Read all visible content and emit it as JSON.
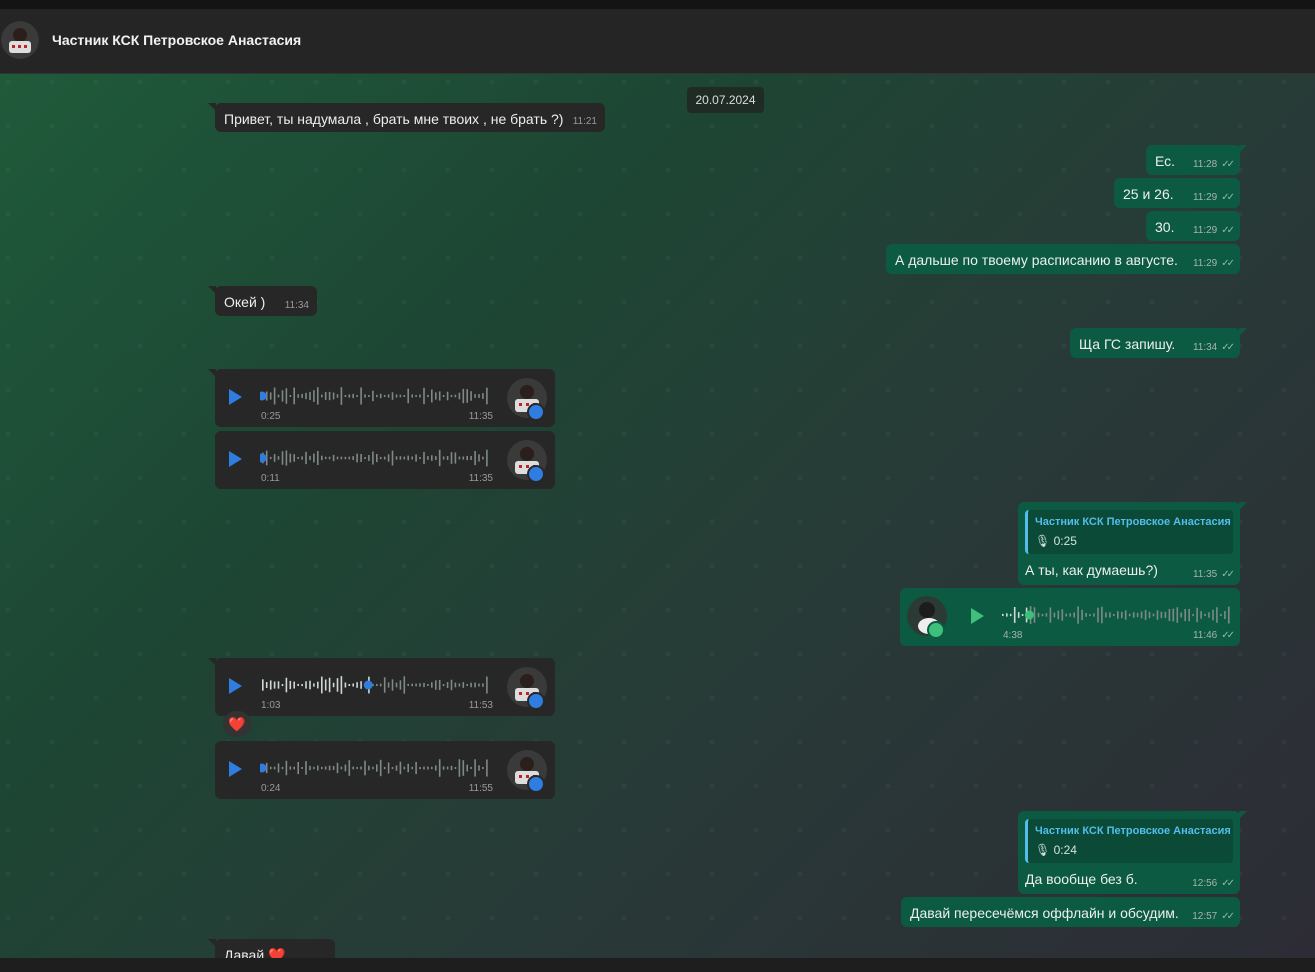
{
  "header": {
    "contact_name": "Частник КСК Петровское Анастасия"
  },
  "chat": {
    "date": "20.07.2024",
    "messages": [
      {
        "type": "in-text",
        "text": "Привет, ты надумала , брать мне твоих , не брать ?)",
        "time": "11:21"
      },
      {
        "type": "out-text",
        "text": "Ес.",
        "time": "11:28"
      },
      {
        "type": "out-text",
        "text": "25 и 26.",
        "time": "11:29"
      },
      {
        "type": "out-text",
        "text": "30.",
        "time": "11:29"
      },
      {
        "type": "out-text",
        "text": "А дальше по твоему расписанию в августе.",
        "time": "11:29"
      },
      {
        "type": "in-text",
        "text": "Окей )",
        "time": "11:34"
      },
      {
        "type": "out-text",
        "text": "Ща ГС запишу.",
        "time": "11:34"
      },
      {
        "type": "in-voice",
        "duration": "0:25",
        "time": "11:35",
        "progress": 0
      },
      {
        "type": "in-voice",
        "duration": "0:11",
        "time": "11:35",
        "progress": 0
      },
      {
        "type": "out-reply",
        "quote_name": "Частник КСК Петровское Анастасия",
        "quote_text": "0:25",
        "text": "А ты, как думаешь?)",
        "time": "11:35"
      },
      {
        "type": "out-voice",
        "duration": "4:38",
        "time": "11:46",
        "progress": 0.12
      },
      {
        "type": "in-voice",
        "duration": "1:03",
        "time": "11:53",
        "progress": 0.47,
        "reaction": "❤️"
      },
      {
        "type": "in-voice",
        "duration": "0:24",
        "time": "11:55",
        "progress": 0
      },
      {
        "type": "out-reply",
        "quote_name": "Частник КСК Петровское Анастасия",
        "quote_text": "0:24",
        "text": "Да вообще без б.",
        "time": "12:56"
      },
      {
        "type": "out-text",
        "text": "Давай пересечёмся оффлайн и обсудим.",
        "time": "12:57"
      },
      {
        "type": "in-text",
        "text": "Давай ❤️",
        "time": ""
      }
    ]
  },
  "icons": {
    "play": "play-icon",
    "mic": "mic-icon",
    "read": "double-check-icon"
  },
  "colors": {
    "incoming": "#272727",
    "outgoing": "#0c5a42",
    "accent": "#2f7de1",
    "quote": "#53bdeb"
  }
}
